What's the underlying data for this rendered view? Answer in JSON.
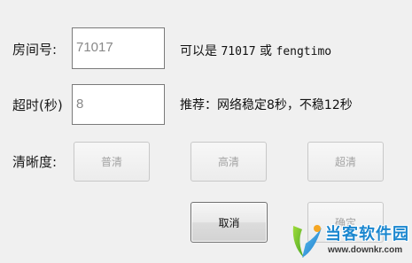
{
  "room": {
    "label": "房间号:",
    "value": "71017",
    "hint_prefix": "可以是",
    "hint_example_1": "71017",
    "hint_or": "或",
    "hint_example_2": "fengtimo"
  },
  "timeout": {
    "label": "超时(秒)",
    "value": "8",
    "hint": "推荐：网络稳定8秒，不稳12秒"
  },
  "quality": {
    "label": "清晰度:",
    "options": [
      "普清",
      "高清",
      "超清"
    ]
  },
  "actions": {
    "cancel_label": "取消",
    "confirm_label": "确定"
  },
  "watermark": {
    "brand": "当客软件园",
    "url": "www.downkr.com"
  }
}
